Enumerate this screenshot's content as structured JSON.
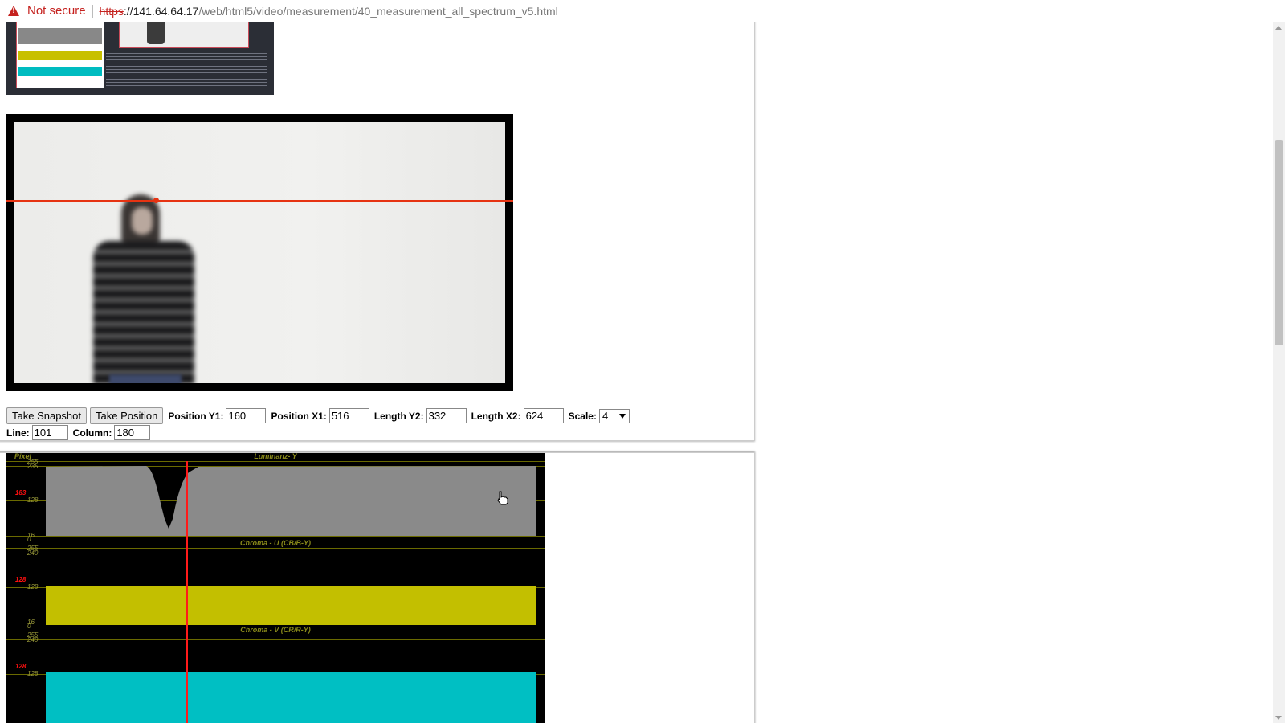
{
  "browser": {
    "security_label": "Not secure",
    "url_scheme": "https",
    "url_rest_host": "://141.64.64.17",
    "url_path": "/web/html5/video/measurement/40_measurement_all_spectrum_v5.html"
  },
  "controls": {
    "take_snapshot": "Take Snapshot",
    "take_position": "Take Position",
    "position_y1_label": "Position Y1:",
    "position_y1_value": "160",
    "position_x1_label": "Position X1:",
    "position_x1_value": "516",
    "length_y2_label": "Length Y2:",
    "length_y2_value": "332",
    "length_x2_label": "Length X2:",
    "length_x2_value": "624",
    "scale_label": "Scale:",
    "scale_value": "4",
    "line_label": "Line:",
    "line_value": "101",
    "column_label": "Column:",
    "column_value": "180"
  },
  "spectrum": {
    "pixel_label": "Pixel",
    "luma": {
      "title": "Luminanz- Y",
      "current": "183",
      "ticks": [
        "255",
        "235",
        "128",
        "16",
        "0"
      ]
    },
    "chroma_u": {
      "title": "Chroma - U (CB/B-Y)",
      "current": "128",
      "ticks": [
        "255",
        "240",
        "128",
        "16",
        "0"
      ]
    },
    "chroma_v": {
      "title": "Chroma - V (CR/R-Y)",
      "current": "128",
      "ticks": [
        "255",
        "240",
        "128"
      ]
    },
    "colors": {
      "luma": "#8a8a8a",
      "chroma_u": "#c3bf00",
      "chroma_v": "#00bfc3",
      "cursor": "#ff1a1a"
    }
  }
}
